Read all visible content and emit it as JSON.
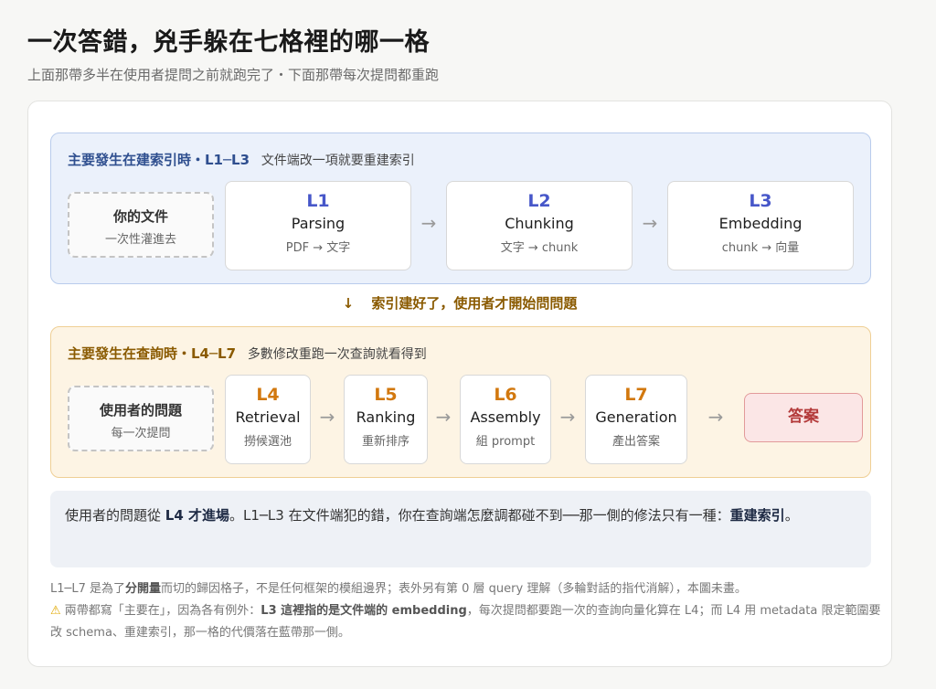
{
  "page": {
    "title": "一次答錯，兇手躲在七格裡的哪一格",
    "subtitle": "上面那帶多半在使用者提問之前就跑完了・下面那帶每次提問都重跑"
  },
  "index_band": {
    "heading": "主要發生在建索引時・L1─L3",
    "note": "文件端改一項就要重建索引",
    "source": {
      "name": "你的文件",
      "desc": "一次性灌進去"
    },
    "steps": [
      {
        "code": "L1",
        "name": "Parsing",
        "desc": "PDF → 文字"
      },
      {
        "code": "L2",
        "name": "Chunking",
        "desc": "文字 → chunk"
      },
      {
        "code": "L3",
        "name": "Embedding",
        "desc": "chunk → 向量"
      }
    ],
    "arrow": "→"
  },
  "transition": {
    "arrow": "↓",
    "text": "索引建好了，使用者才開始問問題"
  },
  "query_band": {
    "heading": "主要發生在查詢時・L4─L7",
    "note": "多數修改重跑一次查詢就看得到",
    "source": {
      "name": "使用者的問題",
      "desc": "每一次提問"
    },
    "steps": [
      {
        "code": "L4",
        "name": "Retrieval",
        "desc": "撈候選池"
      },
      {
        "code": "L5",
        "name": "Ranking",
        "desc": "重新排序"
      },
      {
        "code": "L6",
        "name": "Assembly",
        "desc": "組 prompt"
      },
      {
        "code": "L7",
        "name": "Generation",
        "desc": "產出答案"
      }
    ],
    "arrow": "→",
    "answer": "答案"
  },
  "callout": {
    "p1": "使用者的問題從 ",
    "b1": "L4 才進場",
    "p2": "。L1─L3 在文件端犯的錯，你在查詢端怎麼調都碰不到──那一側的修法只有一種：",
    "b2": "重建索引",
    "p3": "。"
  },
  "footnote": {
    "line1_a": "L1─L7 是為了",
    "line1_b": "分開量",
    "line1_c": "而切的歸因格子，不是任何框架的模組邊界；表外另有第 0 層 query 理解（多輪對話的指代消解），本圖未畫。",
    "warn_icon": "⚠",
    "line2_a": " 兩帶都寫「主要在」，因為各有例外：",
    "line2_b": "L3 這裡指的是文件端的 embedding",
    "line2_c": "，每次提問都要跑一次的查詢向量化算在 L4；而 L4 用 metadata 限定範圍要改 schema、重建索引，那一格的代價落在藍帶那一側。"
  },
  "colors": {
    "blue_band": "#ebf1fb",
    "orange_band": "#fdf4e4",
    "blue_code": "#4757c9",
    "orange_code": "#d2780e",
    "answer_bg": "#fbe6e6"
  }
}
